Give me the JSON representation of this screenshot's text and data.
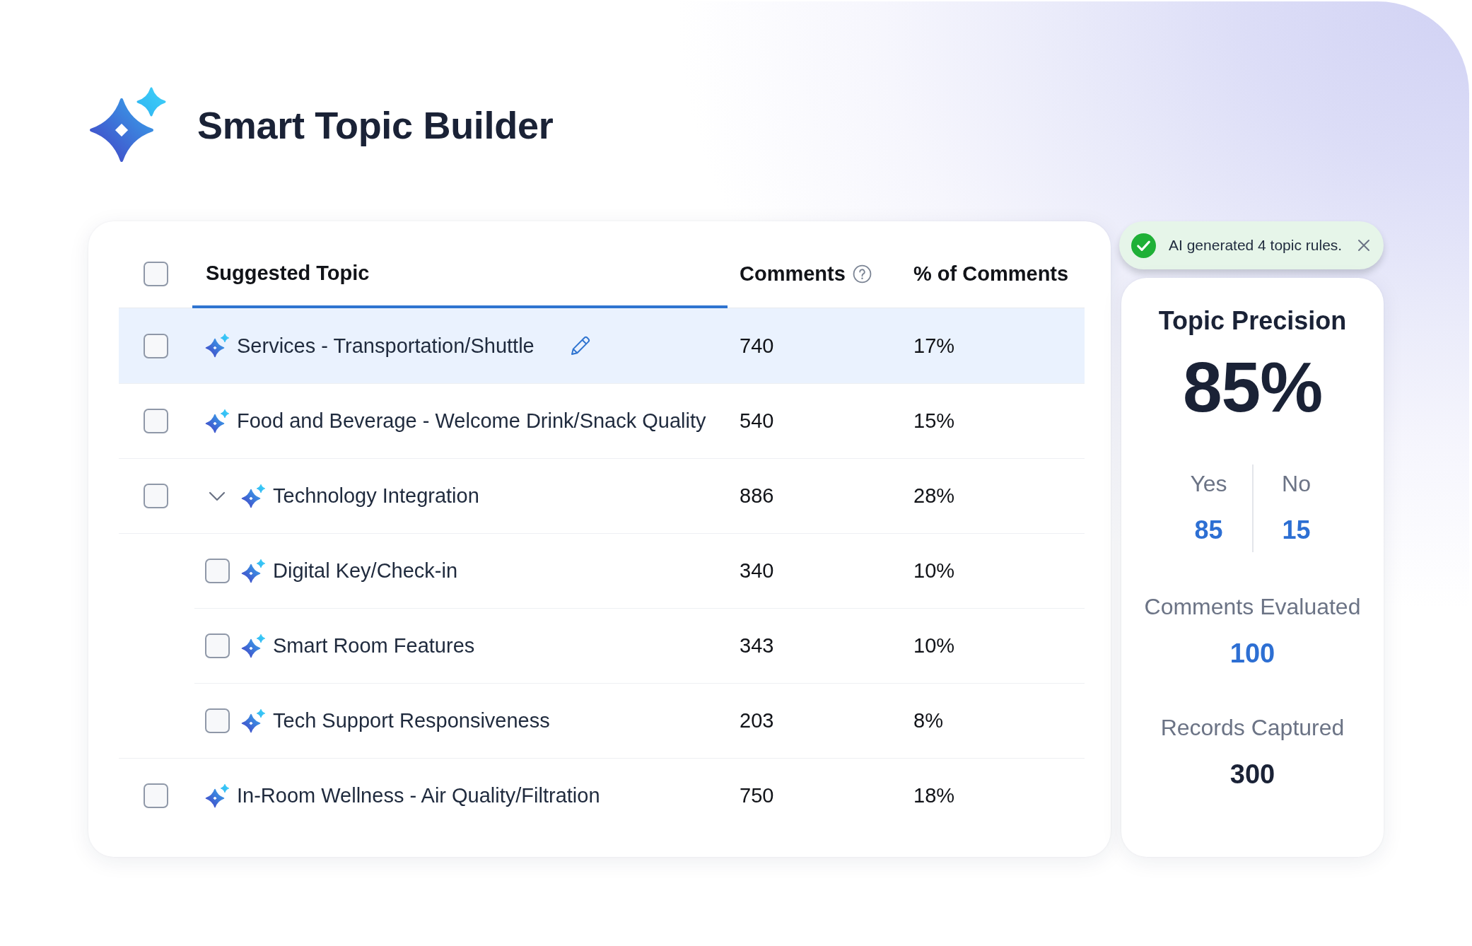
{
  "header": {
    "title": "Smart Topic Builder"
  },
  "table": {
    "select_all": {
      "checked": false
    },
    "columns": [
      {
        "label": "Suggested Topic",
        "selected": true,
        "help": false
      },
      {
        "label": "Comments",
        "selected": false,
        "help": true
      },
      {
        "label": "% of Comments",
        "selected": false,
        "help": false
      }
    ],
    "rows": [
      {
        "topic": "Services - Transportation/Shuttle",
        "comments": "740",
        "percent": "17%",
        "checked": false,
        "selected": true,
        "expanded": false
      },
      {
        "topic": "Food and Beverage - Welcome Drink/Snack Quality",
        "comments": "540",
        "percent": "15%",
        "checked": false,
        "selected": false,
        "expanded": false
      },
      {
        "topic": "Technology Integration",
        "comments": "886",
        "percent": "28%",
        "checked": false,
        "selected": false,
        "expanded": true,
        "children": [
          {
            "topic": "Digital Key/Check-in",
            "comments": "340",
            "percent": "10%",
            "checked": false,
            "selected": false
          },
          {
            "topic": "Smart Room Features",
            "comments": "343",
            "percent": "10%",
            "checked": false,
            "selected": false
          },
          {
            "topic": "Tech Support Responsiveness",
            "comments": "203",
            "percent": "8%",
            "checked": false,
            "selected": false
          }
        ]
      },
      {
        "topic": "In-Room Wellness - Air Quality/Filtration",
        "comments": "750",
        "percent": "18%",
        "checked": false,
        "selected": false,
        "expanded": false
      }
    ]
  },
  "notification": {
    "kind": "success",
    "message": "AI generated 4 topic rules."
  },
  "precision_panel": {
    "title": "Topic Precision",
    "value": "85%",
    "split": [
      {
        "label": "Yes",
        "value": "85",
        "kind": "link"
      },
      {
        "label": "No",
        "value": "15",
        "kind": "link"
      }
    ],
    "stats": [
      {
        "label": "Comments Evaluated",
        "value": "100",
        "kind": "link"
      },
      {
        "label": "Records Captured",
        "value": "300",
        "kind": "plain"
      }
    ]
  }
}
